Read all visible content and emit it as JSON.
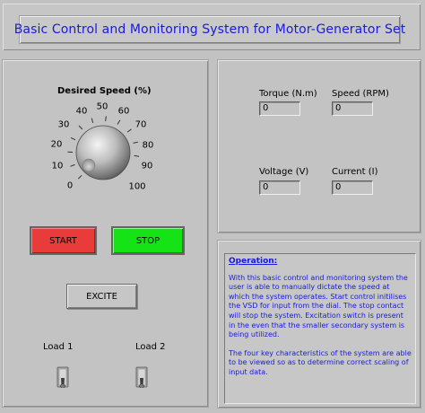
{
  "title": "Basic Control and Monitoring System for Motor-Generator Set",
  "knob": {
    "label": "Desired Speed (%)",
    "scale": [
      "0",
      "10",
      "20",
      "30",
      "40",
      "50",
      "60",
      "70",
      "80",
      "90",
      "100"
    ],
    "value": 0
  },
  "buttons": {
    "start": "START",
    "stop": "STOP",
    "excite": "EXCITE"
  },
  "loads": {
    "load1": "Load 1",
    "load2": "Load 2"
  },
  "indicators": {
    "torque_label": "Torque (N.m)",
    "torque_value": "0",
    "speed_label": "Speed (RPM)",
    "speed_value": "0",
    "voltage_label": "Voltage (V)",
    "voltage_value": "0",
    "current_label": "Current (I)",
    "current_value": "0"
  },
  "description": {
    "heading": "Operation:",
    "para1": "With this basic control and monitoring system the user is able to manually dictate the speed at which the system operates. Start control initilises the VSD for input from the dial. The stop contact will stop the system. Excitation switch is present in the even that the smaller secondary system is being utilized.",
    "para2": "The four key characteristics of the system are able to be viewed so as to determine correct scaling of input data."
  },
  "colors": {
    "background": "#c2c2c2",
    "title_text": "#1a1adc",
    "start_button": "#ea3b3b",
    "stop_button": "#16e316",
    "description_text": "#1a1adc"
  }
}
